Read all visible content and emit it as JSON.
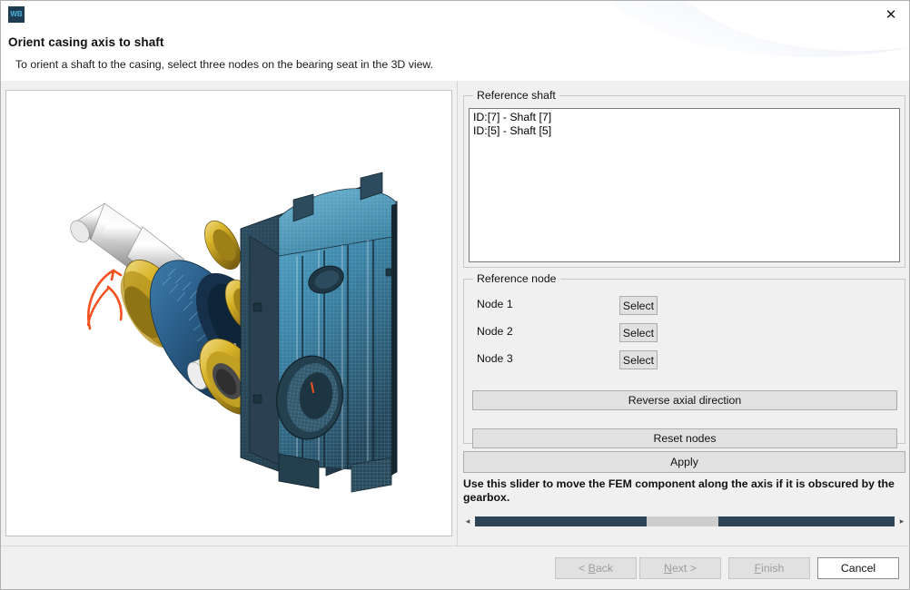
{
  "window": {
    "app_icon_text": "WB",
    "close_icon": "close-icon",
    "close_glyph": "✕"
  },
  "header": {
    "title": "Orient casing axis to shaft",
    "subtitle": "To orient a shaft to the casing, select three nodes on the bearing seat in the 3D view."
  },
  "viewport": {
    "name": "3d-model-view",
    "model": "gearbox casing with shaft, helical gear and bearings",
    "background": "#ffffff",
    "colors": {
      "casing_mesh": "#3f8fb5",
      "casing_dark": "#2b3c48",
      "gear_blue": "#1f4e79",
      "bearing_gold": "#c9a227",
      "shaft_silver": "#d8d8d8",
      "arrow_orange": "#f4511e"
    }
  },
  "reference_shaft": {
    "group_title": "Reference shaft",
    "items": [
      "ID:[7] - Shaft [7]",
      "ID:[5] - Shaft [5]"
    ]
  },
  "reference_node": {
    "group_title": "Reference node",
    "nodes": [
      {
        "label": "Node 1",
        "button": "Select"
      },
      {
        "label": "Node 2",
        "button": "Select"
      },
      {
        "label": "Node 3",
        "button": "Select"
      }
    ],
    "reverse_button": "Reverse axial direction",
    "reset_button": "Reset nodes"
  },
  "apply": {
    "label": "Apply"
  },
  "slider": {
    "hint": "Use this slider to move the FEM component along the axis if it is obscured by the gearbox.",
    "left_arrow": "◂",
    "right_arrow": "▸",
    "thumb_position_percent": 41,
    "thumb_width_percent": 17
  },
  "footer": {
    "buttons": [
      {
        "id": "back",
        "label": "< Back",
        "enabled": false
      },
      {
        "id": "next",
        "label": "Next >",
        "enabled": false
      },
      {
        "id": "finish",
        "label": "Finish",
        "enabled": false
      },
      {
        "id": "cancel",
        "label": "Cancel",
        "enabled": true
      }
    ]
  }
}
